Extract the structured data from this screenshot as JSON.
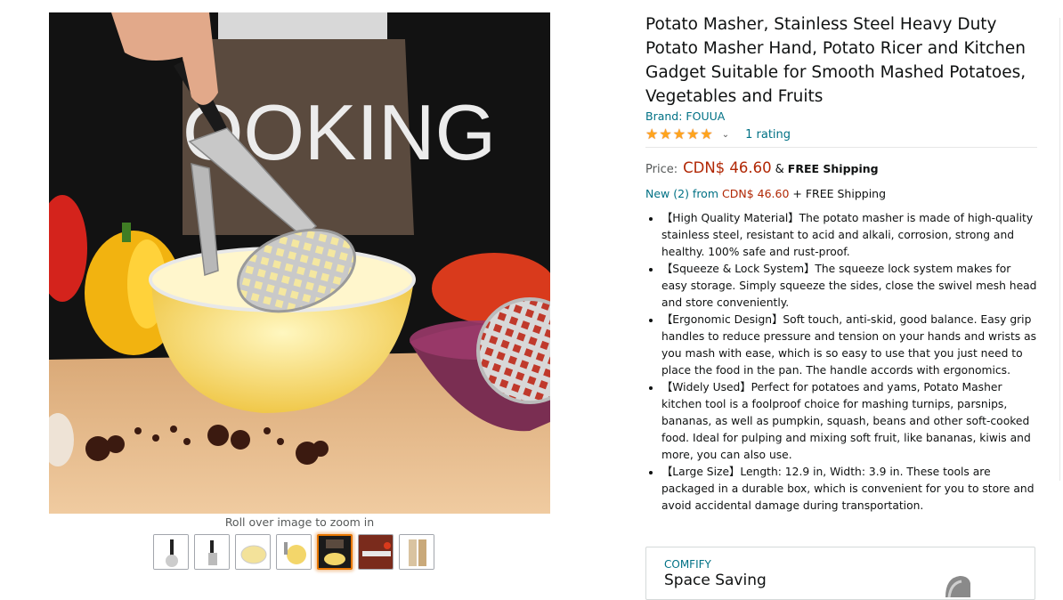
{
  "gallery": {
    "zoom_hint": "Roll over image to zoom in",
    "apron_text": "OOKING",
    "thumbnails": [
      {
        "name": "thumb-masher-front",
        "selected": false
      },
      {
        "name": "thumb-masher-side",
        "selected": false
      },
      {
        "name": "thumb-bowl",
        "selected": false
      },
      {
        "name": "thumb-masher-potato",
        "selected": false
      },
      {
        "name": "thumb-cooking-scene",
        "selected": true
      },
      {
        "name": "thumb-dimensions",
        "selected": false
      },
      {
        "name": "thumb-box",
        "selected": false
      }
    ]
  },
  "product": {
    "title": "Potato Masher, Stainless Steel Heavy Duty Potato Masher Hand, Potato Ricer and Kitchen Gadget Suitable for Smooth Mashed Potatoes, Vegetables and Fruits",
    "brand": "Brand: FOUUA",
    "stars": 5,
    "rating_count": "1 rating",
    "price_label": "Price:",
    "price": "CDN$ 46.60",
    "amp": "&",
    "shipping": "FREE Shipping",
    "new_offers": "New (2) from",
    "new_price": "CDN$ 46.60",
    "new_shipping": "+ FREE Shipping",
    "bullets": [
      "【High Quality Material】The potato masher is made of high-quality stainless steel, resistant to acid and alkali, corrosion, strong and healthy. 100% safe and rust-proof.",
      "【Squeeze & Lock System】The squeeze lock system makes for easy storage. Simply squeeze the sides, close the swivel mesh head and store conveniently.",
      "【Ergonomic Design】Soft touch, anti-skid, good balance. Easy grip handles to reduce pressure and tension on your hands and wrists as you mash with ease, which is so easy to use that you just need to place the food in the pan. The handle accords with ergonomics.",
      "【Widely Used】Perfect for potatoes and yams, Potato Masher kitchen tool is a foolproof choice for mashing turnips, parsnips, bananas, as well as pumpkin, squash, beans and other soft-cooked food. Ideal for pulping and mixing soft fruit, like bananas, kiwis and more, you can also use.",
      "【Large Size】Length: 12.9 in, Width: 3.9 in. These tools are packaged in a durable box, which is convenient for you to store and avoid accidental damage during transportation."
    ]
  },
  "ad": {
    "brand": "COMFIFY",
    "headline": "Space Saving"
  },
  "colors": {
    "link": "#007185",
    "price": "#b12704",
    "star": "#ffa41c",
    "thumb_selected": "#e77600"
  },
  "icons": {
    "star": "star-icon",
    "chevron": "chevron-down-icon"
  }
}
